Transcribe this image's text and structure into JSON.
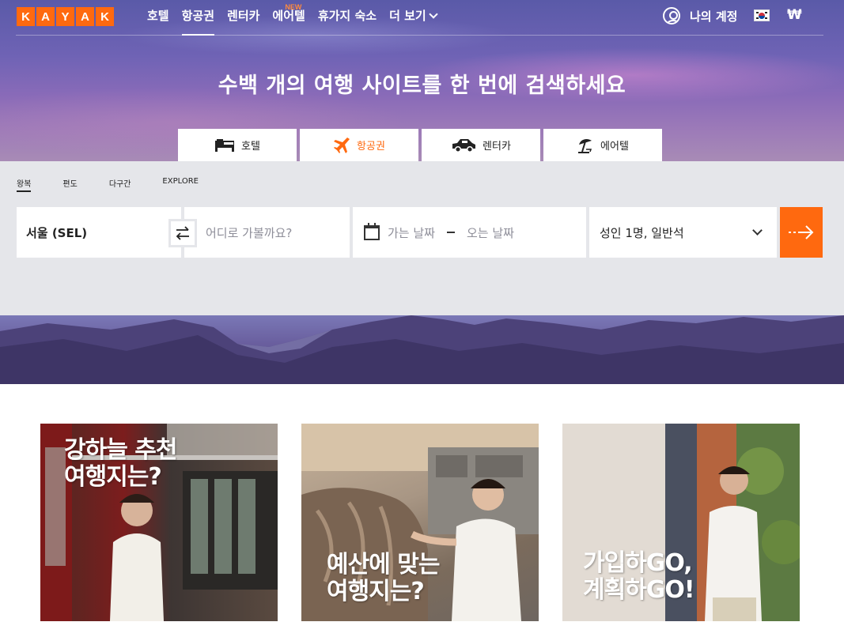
{
  "brand": {
    "logo_letters": [
      "K",
      "A",
      "Y",
      "A",
      "K"
    ],
    "accent_color": "#ff690f"
  },
  "nav": {
    "items": [
      {
        "label": "호텔"
      },
      {
        "label": "항공권"
      },
      {
        "label": "렌터카"
      },
      {
        "label": "에어텔",
        "badge": "NEW"
      },
      {
        "label": "휴가지 숙소"
      },
      {
        "label": "더 보기"
      }
    ],
    "account_label": "나의 계정",
    "country_flag_icon": "south-korea-flag-icon",
    "currency": "₩"
  },
  "hero": {
    "headline": "수백 개의 여행 사이트를 한 번에 검색하세요",
    "tabs": [
      {
        "label": "호텔",
        "icon": "bed-icon"
      },
      {
        "label": "항공권",
        "icon": "plane-icon"
      },
      {
        "label": "렌터카",
        "icon": "car-icon"
      },
      {
        "label": "에어텔",
        "icon": "beach-umbrella-icon"
      }
    ]
  },
  "search": {
    "trip_types": [
      "왕복",
      "편도",
      "다구간",
      "EXPLORE"
    ],
    "origin": "서울 (SEL)",
    "destination_placeholder": "어디로 가볼까요?",
    "depart_placeholder": "가는 날짜",
    "return_placeholder": "오는 날짜",
    "travelers": "성인 1명, 일반석"
  },
  "promos": [
    {
      "caption": "강하늘 추천\n여행지는?"
    },
    {
      "caption": "예산에 맞는\n여행지는?"
    },
    {
      "caption": "가입하GO,\n계획하GO!"
    }
  ]
}
